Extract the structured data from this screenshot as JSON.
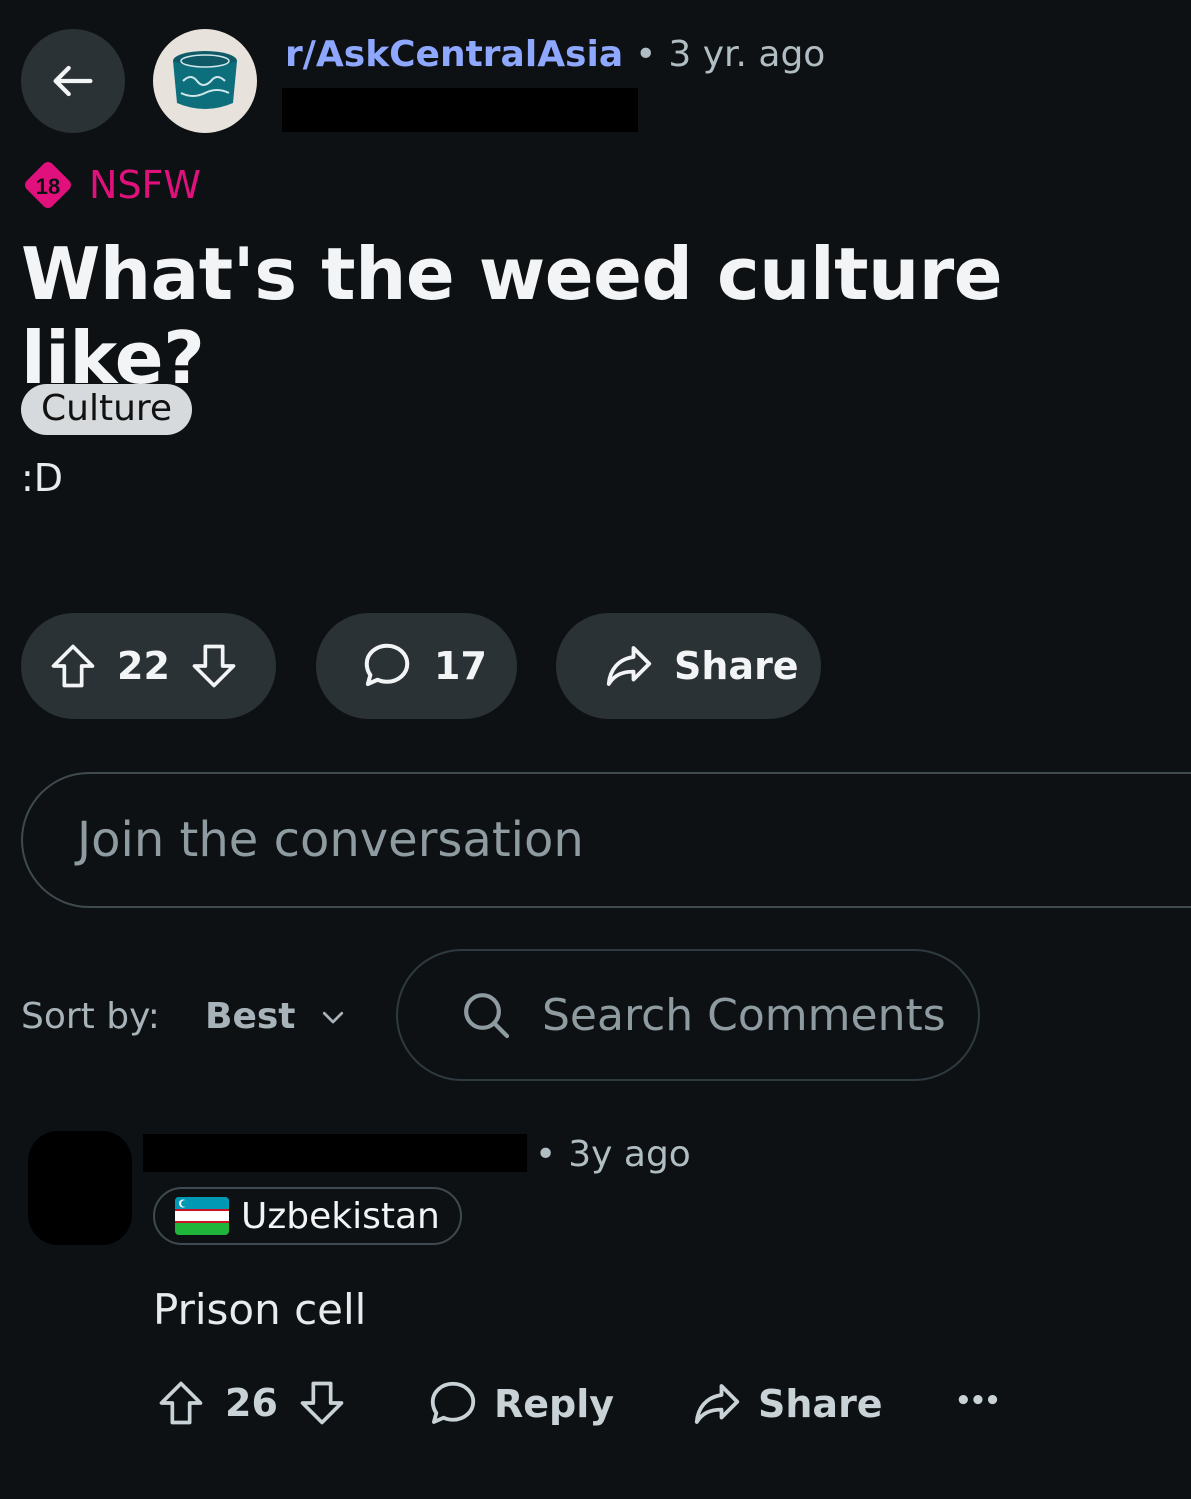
{
  "header": {
    "subreddit": "r/AskCentralAsia",
    "separator": "•",
    "time": "3 yr. ago"
  },
  "post": {
    "nsfw_badge_number": "18",
    "nsfw_label": "NSFW",
    "title": "What's the weed culture like?",
    "flair": "Culture",
    "body": ":D"
  },
  "actions": {
    "votes": "22",
    "comments": "17",
    "share": "Share"
  },
  "composer": {
    "placeholder": "Join the conversation"
  },
  "sort": {
    "label": "Sort by:",
    "value": "Best",
    "search_placeholder": "Search Comments"
  },
  "comment": {
    "separator": "•",
    "time": "3y ago",
    "user_flair": "Uzbekistan",
    "body": "Prison cell",
    "votes": "26",
    "reply": "Reply",
    "share": "Share",
    "more": "•••"
  },
  "colors": {
    "background": "#0e1113",
    "subreddit_link": "#8fa8ff",
    "nsfw": "#e0107c",
    "pill_bg": "#2a3236"
  },
  "icons": [
    "back-arrow-icon",
    "upvote-icon",
    "downvote-icon",
    "comment-icon",
    "share-icon",
    "search-icon",
    "chevron-down-icon",
    "more-icon"
  ]
}
